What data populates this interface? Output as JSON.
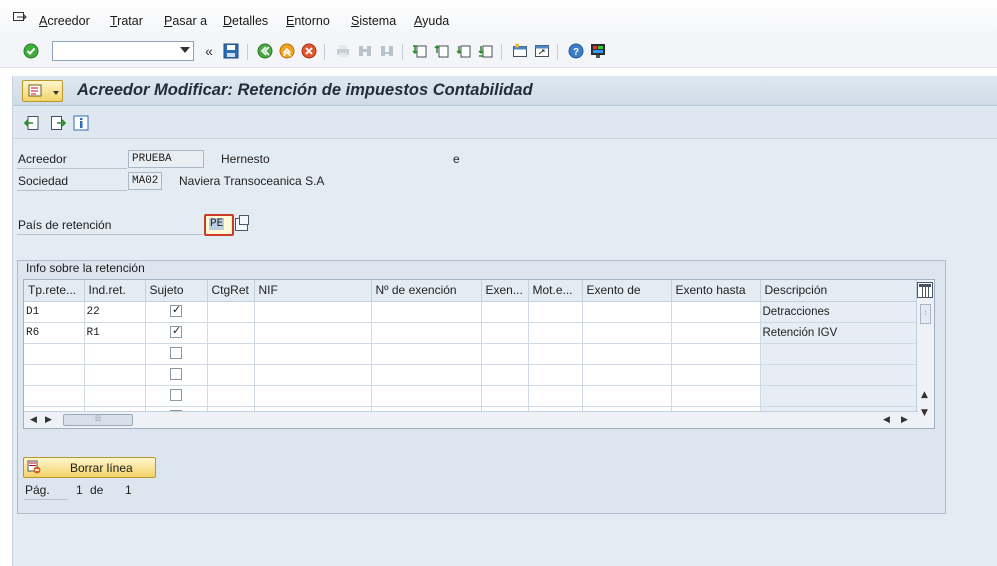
{
  "menu": [
    "Acreedor",
    "Tratar",
    "Pasar a",
    "Detalles",
    "Entorno",
    "Sistema",
    "Ayuda"
  ],
  "toolbar": {
    "command_value": "",
    "back_label": "«"
  },
  "title": "Acreedor Modificar: Retención de impuestos Contabilidad",
  "header": {
    "acreedor_label": "Acreedor",
    "acreedor_value": "PRUEBA",
    "acreedor_name": "Hernesto",
    "acreedor_extra": "e",
    "sociedad_label": "Sociedad",
    "sociedad_value": "MA02",
    "sociedad_name": "Naviera Transoceanica S.A",
    "pais_label": "País de retención",
    "pais_value": "PE"
  },
  "group": {
    "title": "Info sobre la retención",
    "columns": [
      "Tp.rete...",
      "Ind.ret.",
      "Sujeto",
      "CtgRet",
      "NIF",
      "Nº de exención",
      "Exen...",
      "Mot.e...",
      "Exento de",
      "Exento hasta",
      "Descripción"
    ],
    "rows": [
      {
        "tp": "D1",
        "ind": "22",
        "sujeto": true,
        "desc": "Detracciones"
      },
      {
        "tp": "R6",
        "ind": "R1",
        "sujeto": true,
        "desc": "Retención IGV"
      },
      {
        "tp": "",
        "ind": "",
        "sujeto": false,
        "desc": ""
      },
      {
        "tp": "",
        "ind": "",
        "sujeto": false,
        "desc": ""
      },
      {
        "tp": "",
        "ind": "",
        "sujeto": false,
        "desc": ""
      },
      {
        "tp": "",
        "ind": "",
        "sujeto": false,
        "desc": ""
      }
    ],
    "delete_button": "Borrar línea",
    "page_label": "Pág.",
    "page_current": "1",
    "page_of": "de",
    "page_total": "1"
  },
  "colors": {
    "accent_yellow": "#f2d36a",
    "panel": "#e3ebf3",
    "error_border": "#cc3a2a"
  }
}
